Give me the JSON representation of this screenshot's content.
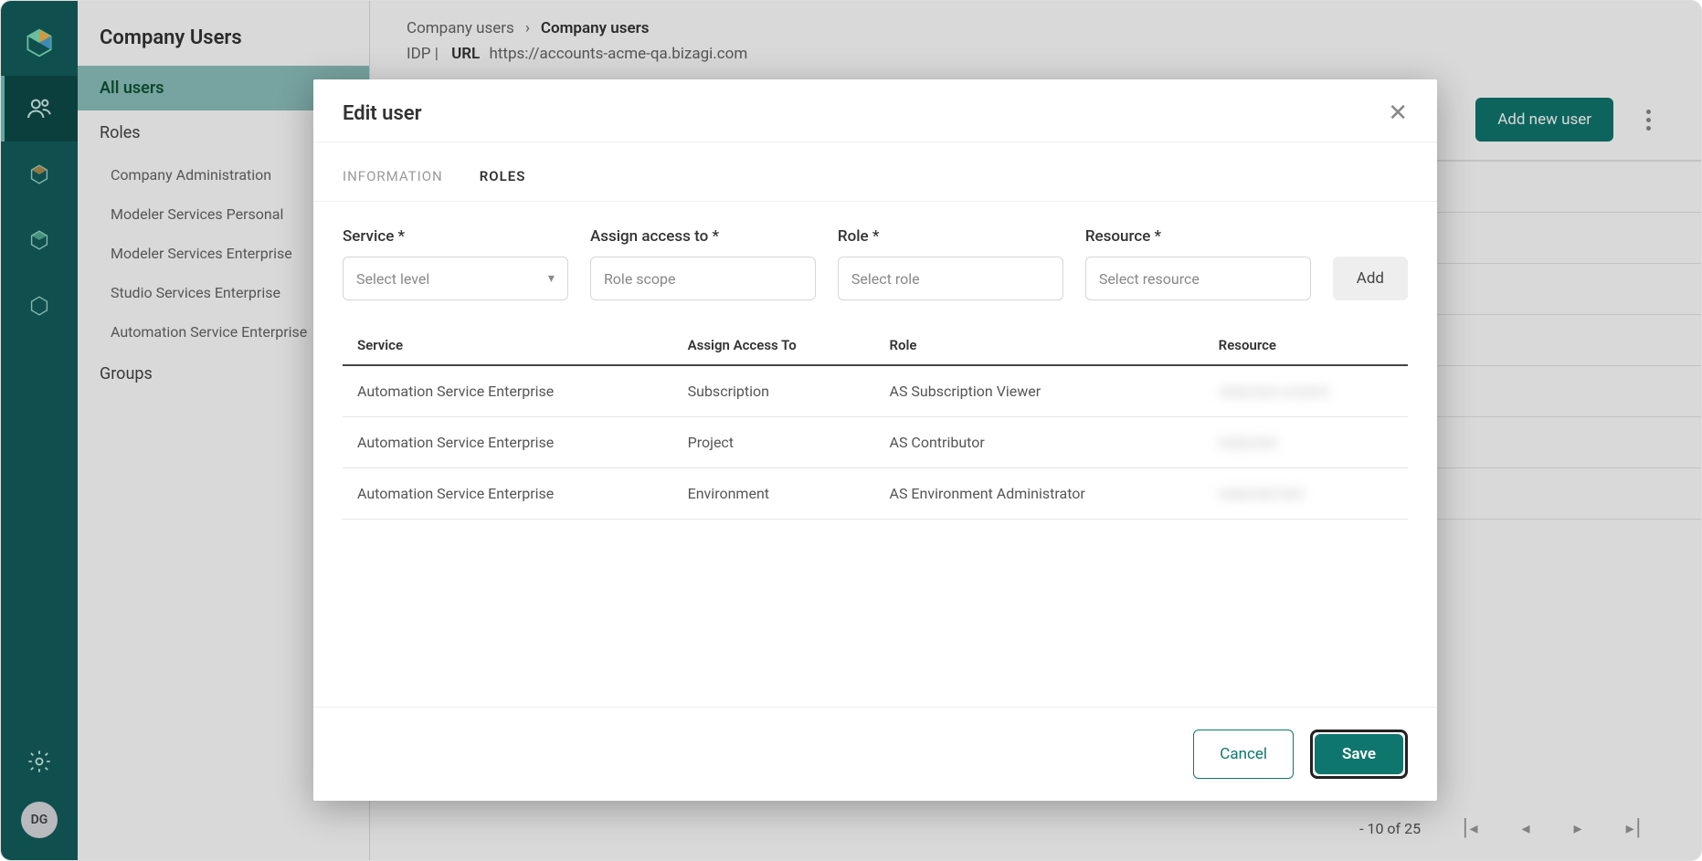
{
  "rail": {
    "avatar": "DG"
  },
  "sidebar": {
    "title": "Company Users",
    "items": [
      {
        "label": "All users",
        "selected": true
      },
      {
        "label": "Roles"
      },
      {
        "label": "Company Administration",
        "sub": true
      },
      {
        "label": "Modeler Services Personal",
        "sub": true
      },
      {
        "label": "Modeler Services Enterprise",
        "sub": true
      },
      {
        "label": "Studio Services Enterprise",
        "sub": true
      },
      {
        "label": "Automation Service Enterprise",
        "sub": true
      },
      {
        "label": "Groups"
      }
    ]
  },
  "breadcrumb": {
    "parent": "Company users",
    "current": "Company users"
  },
  "idp": {
    "prefix": "IDP  |",
    "url_label": "URL",
    "url_value": "https://accounts-acme-qa.bizagi.com"
  },
  "toolbar": {
    "add_new_user": "Add new user"
  },
  "pagination": {
    "range_text": "- 10 of 25"
  },
  "modal": {
    "title": "Edit user",
    "tabs": {
      "information": "INFORMATION",
      "roles": "ROLES"
    },
    "form": {
      "service_label": "Service *",
      "service_placeholder": "Select level",
      "access_label": "Assign access to *",
      "access_placeholder": "Role scope",
      "role_label": "Role *",
      "role_placeholder": "Select role",
      "resource_label": "Resource *",
      "resource_placeholder": "Select resource",
      "add_btn": "Add"
    },
    "table": {
      "headers": {
        "service": "Service",
        "access": "Assign Access To",
        "role": "Role",
        "resource": "Resource"
      },
      "rows": [
        {
          "service": "Automation Service Enterprise",
          "access": "Subscription",
          "role": "AS Subscription Viewer",
          "resource": "redacted content"
        },
        {
          "service": "Automation Service Enterprise",
          "access": "Project",
          "role": "AS Contributor",
          "resource": "redacted"
        },
        {
          "service": "Automation Service Enterprise",
          "access": "Environment",
          "role": "AS Environment Administrator",
          "resource": "redacted text"
        }
      ]
    },
    "footer": {
      "cancel": "Cancel",
      "save": "Save"
    }
  }
}
